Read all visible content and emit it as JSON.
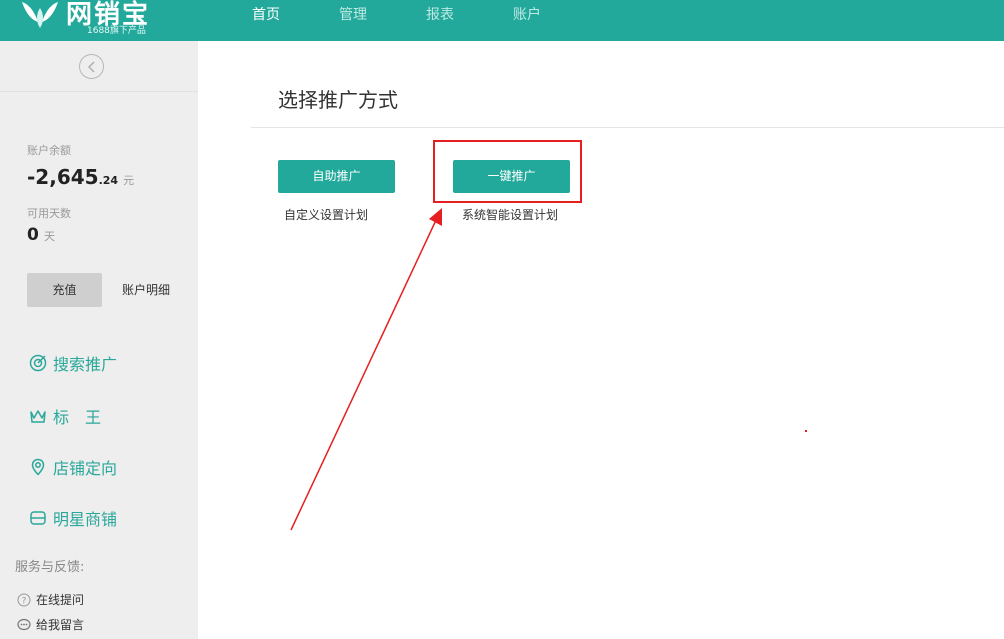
{
  "app": {
    "logo_text": "网销宝",
    "logo_sub": "1688旗下产品",
    "brand_color": "#22a99b"
  },
  "nav": {
    "items": [
      {
        "label": "首页",
        "active": true
      },
      {
        "label": "管理",
        "active": false
      },
      {
        "label": "报表",
        "active": false
      },
      {
        "label": "账户",
        "active": false
      }
    ]
  },
  "sidebar": {
    "collapse_icon": "chevron-left-circle-icon",
    "balance_label": "账户余额",
    "balance_int": "-2,645",
    "balance_dec": ".24",
    "balance_unit": "元",
    "days_label": "可用天数",
    "days_value": "0",
    "days_unit": "天",
    "recharge_label": "充值",
    "detail_label": "账户明细",
    "menu": [
      {
        "label": "搜索推广",
        "icon": "target-icon"
      },
      {
        "label": "标　王",
        "icon": "crown-icon"
      },
      {
        "label": "店铺定向",
        "icon": "location-pin-icon"
      },
      {
        "label": "明星商铺",
        "icon": "store-icon"
      }
    ],
    "service_title": "服务与反馈:",
    "service_items": [
      {
        "label": "在线提问",
        "icon": "question-circle-icon"
      },
      {
        "label": "给我留言",
        "icon": "chat-bubble-icon"
      }
    ]
  },
  "main": {
    "title": "选择推广方式",
    "options": [
      {
        "button": "自助推广",
        "desc": "自定义设置计划"
      },
      {
        "button": "一键推广",
        "desc": "系统智能设置计划"
      }
    ]
  },
  "annotation": {
    "color": "#e62020",
    "shapes": [
      "highlight-box",
      "arrow"
    ]
  }
}
